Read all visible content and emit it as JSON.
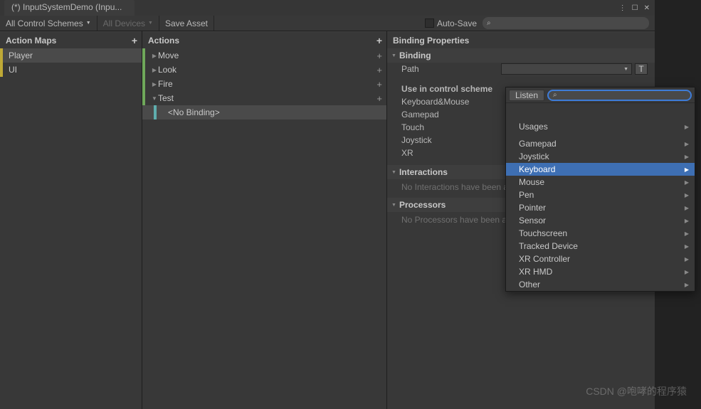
{
  "title_tab": "(*) InputSystemDemo (Inpu...",
  "toolbar": {
    "control_schemes": "All Control Schemes",
    "devices": "All Devices",
    "save_asset": "Save Asset",
    "auto_save": "Auto-Save"
  },
  "panels": {
    "action_maps": {
      "title": "Action Maps",
      "items": [
        "Player",
        "UI"
      ]
    },
    "actions": {
      "title": "Actions",
      "items": [
        {
          "label": "Move",
          "open": false
        },
        {
          "label": "Look",
          "open": false
        },
        {
          "label": "Fire",
          "open": false
        },
        {
          "label": "Test",
          "open": true,
          "children": [
            {
              "label": "<No Binding>",
              "selected": true
            }
          ]
        }
      ]
    },
    "binding": {
      "title": "Binding Properties",
      "binding_hdr": "Binding",
      "path_label": "Path",
      "use_in_scheme": "Use in control scheme",
      "schemes": [
        "Keyboard&Mouse",
        "Gamepad",
        "Touch",
        "Joystick",
        "XR"
      ],
      "interactions_hdr": "Interactions",
      "interactions_empty": "No Interactions have been added.",
      "processors_hdr": "Processors",
      "processors_empty": "No Processors have been added."
    }
  },
  "popup": {
    "listen": "Listen",
    "group1": [
      "Usages"
    ],
    "group2": [
      "Gamepad",
      "Joystick",
      "Keyboard",
      "Mouse",
      "Pen",
      "Pointer",
      "Sensor",
      "Touchscreen",
      "Tracked Device",
      "XR Controller",
      "XR HMD",
      "Other"
    ],
    "highlighted": "Keyboard"
  },
  "watermark": "CSDN @咆哮的程序猿"
}
